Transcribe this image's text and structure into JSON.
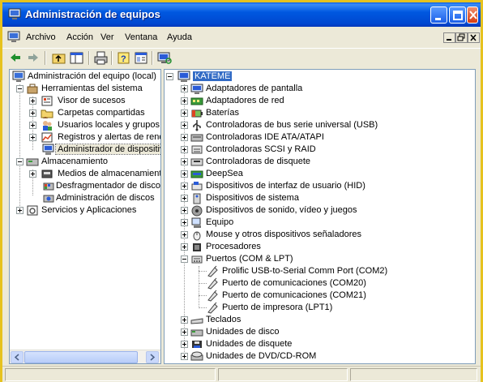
{
  "window": {
    "title": "Administración de equipos"
  },
  "menu": {
    "items": [
      "Archivo",
      "Acción",
      "Ver",
      "Ventana",
      "Ayuda"
    ]
  },
  "left_tree": {
    "root": "Administración del equipo (local)",
    "system_tools": "Herramientas del sistema",
    "event_viewer": "Visor de sucesos",
    "shared_folders": "Carpetas compartidas",
    "local_users": "Usuarios locales y grupos",
    "perf_logs": "Registros y alertas de rendir",
    "device_manager": "Administrador de dispositivo",
    "storage": "Almacenamiento",
    "removable_storage": "Medios de almacenamiento e",
    "defrag": "Desfragmentador de disco",
    "disk_mgmt": "Administración de discos",
    "services_apps": "Servicios y Aplicaciones"
  },
  "right_tree": {
    "computer": "KATEME",
    "categories": [
      "Adaptadores de pantalla",
      "Adaptadores de red",
      "Baterías",
      "Controladoras de bus serie universal (USB)",
      "Controladoras IDE ATA/ATAPI",
      "Controladoras SCSI y RAID",
      "Controladoras de disquete",
      "DeepSea",
      "Dispositivos de interfaz de usuario (HID)",
      "Dispositivos de sistema",
      "Dispositivos de sonido, vídeo y juegos",
      "Equipo",
      "Mouse y otros dispositivos señaladores",
      "Procesadores",
      "Puertos (COM & LPT)"
    ],
    "ports": [
      "Prolific USB-to-Serial Comm Port (COM2)",
      "Puerto de comunicaciones (COM20)",
      "Puerto de comunicaciones (COM21)",
      "Puerto de impresora (LPT1)"
    ],
    "categories_after": [
      "Teclados",
      "Unidades de disco",
      "Unidades de disquete",
      "Unidades de DVD/CD-ROM"
    ]
  },
  "icons": {
    "app": "computer-management-icon",
    "back": "back-arrow-icon",
    "forward": "forward-arrow-icon",
    "up": "up-folder-icon",
    "show_tree": "console-tree-icon",
    "print": "print-icon",
    "help": "help-icon",
    "properties": "properties-icon",
    "scan": "scan-hardware-icon"
  },
  "colors": {
    "titlebar": "#0058e0",
    "selection": "#316ac5",
    "frame": "#e6c21e"
  }
}
